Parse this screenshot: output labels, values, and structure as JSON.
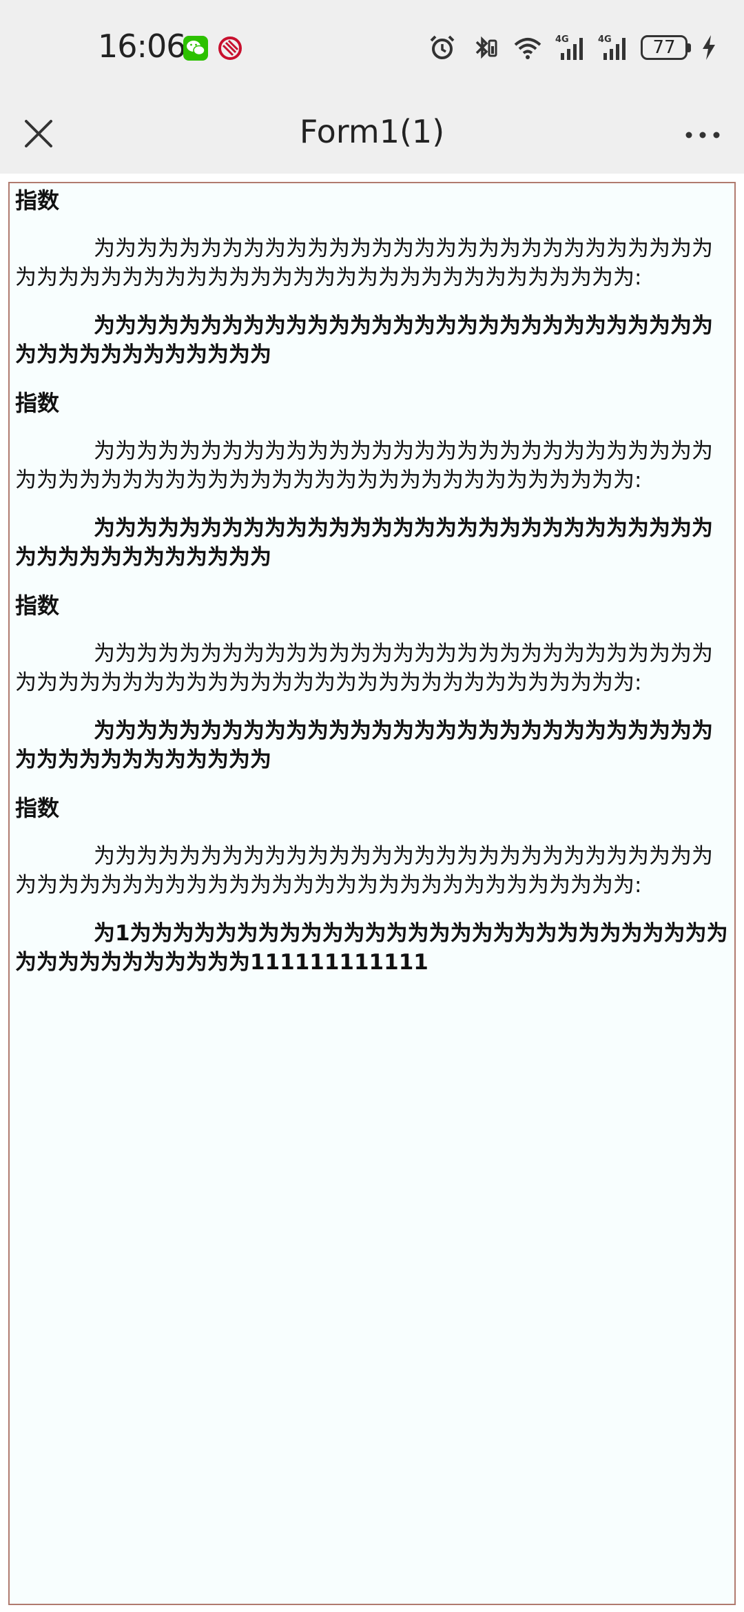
{
  "status_bar": {
    "time": "16:06",
    "battery_level": "77",
    "icons": [
      "wechat-icon",
      "app-notification-icon",
      "alarm-icon",
      "bluetooth-icon",
      "wifi-icon",
      "signal-4g-icon",
      "signal-4g-icon",
      "battery-icon",
      "charging-icon"
    ]
  },
  "nav": {
    "title": "Form1(1)",
    "close_icon": "close-icon",
    "more_icon": "more-icon"
  },
  "colors": {
    "frame_border": "#b07a6e",
    "frame_background": "#f8fefe",
    "wechat_green": "#2dc100",
    "app_red": "#c8102e"
  },
  "sections": [
    {
      "heading": "指数",
      "body": "为为为为为为为为为为为为为为为为为为为为为为为为为为为为为为为为为为为为为为为为为为为为为为为为为为为为为为为为为为:",
      "strong": "为为为为为为为为为为为为为为为为为为为为为为为为为为为为为为为为为为为为为为为为为"
    },
    {
      "heading": "指数",
      "body": "为为为为为为为为为为为为为为为为为为为为为为为为为为为为为为为为为为为为为为为为为为为为为为为为为为为为为为为为为为:",
      "strong": "为为为为为为为为为为为为为为为为为为为为为为为为为为为为为为为为为为为为为为为为为"
    },
    {
      "heading": "指数",
      "body": "为为为为为为为为为为为为为为为为为为为为为为为为为为为为为为为为为为为为为为为为为为为为为为为为为为为为为为为为为为:",
      "strong": "为为为为为为为为为为为为为为为为为为为为为为为为为为为为为为为为为为为为为为为为为"
    },
    {
      "heading": "指数",
      "body": "为为为为为为为为为为为为为为为为为为为为为为为为为为为为为为为为为为为为为为为为为为为为为为为为为为为为为为为为为为:",
      "strong": "为1为为为为为为为为为为为为为为为为为为为为为为为为为为为为为为为为为为为为为为为111111111111"
    }
  ]
}
